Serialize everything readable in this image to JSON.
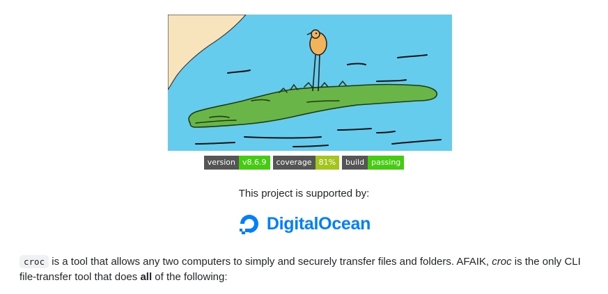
{
  "hero_image": {
    "alt": "croc",
    "colors": {
      "water": "#66ccee",
      "sand": "#f8e4bc",
      "croc": "#6ab547",
      "bird": "#f2b45b"
    }
  },
  "badges": [
    {
      "label": "version",
      "value": "v8.6.9",
      "color": "#4c1"
    },
    {
      "label": "coverage",
      "value": "81%",
      "color": "#a3c51c"
    },
    {
      "label": "build",
      "value": "passing",
      "color": "#4c1"
    }
  ],
  "supported_text": "This project is supported by:",
  "sponsor": {
    "name": "DigitalOcean",
    "logo_icon": "digitalocean-icon",
    "color": "#0080ff"
  },
  "intro": {
    "code": "croc",
    "text1": " is a tool that allows any two computers to simply and securely transfer files and folders. AFAIK, ",
    "emph": "croc",
    "text2": " is the only CLI file-transfer tool that does ",
    "strong": "all",
    "text3": " of the following:"
  }
}
